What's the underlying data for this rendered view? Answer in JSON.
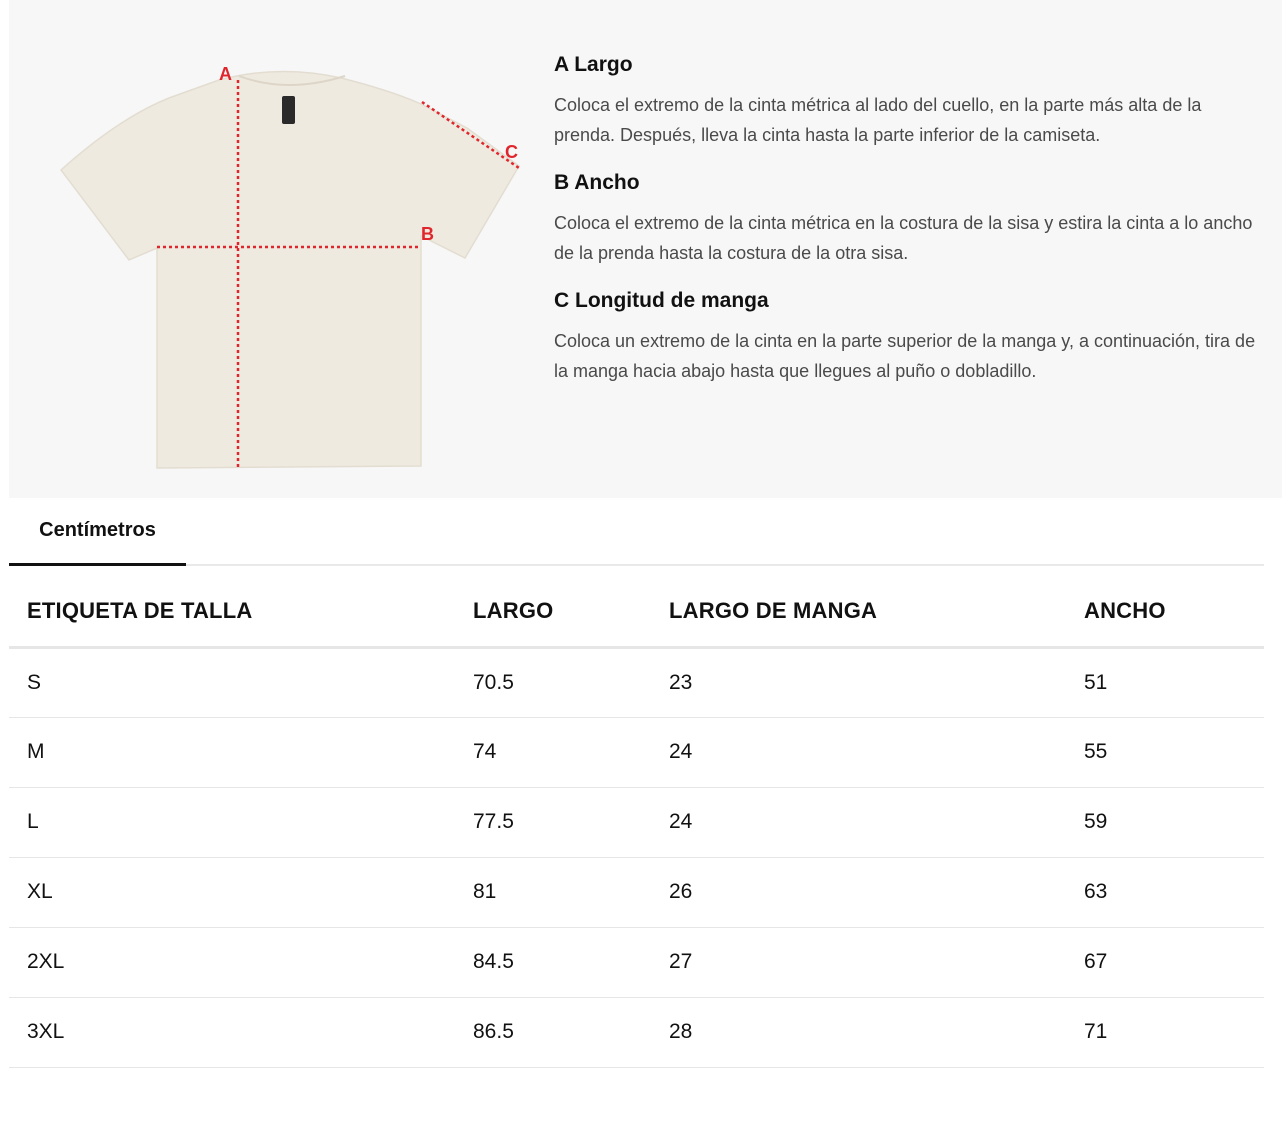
{
  "measurement_guide": {
    "markers": {
      "a": "A",
      "b": "B",
      "c": "C"
    },
    "items": [
      {
        "title": "A Largo",
        "text": "Coloca el extremo de la cinta métrica al lado del cuello, en la parte más alta de la prenda. Después, lleva la cinta hasta la parte inferior de la camiseta."
      },
      {
        "title": "B Ancho",
        "text": "Coloca el extremo de la cinta métrica en la costura de la sisa y estira la cinta a lo ancho de la prenda hasta la costura de la otra sisa."
      },
      {
        "title": "C Longitud de manga",
        "text": "Coloca un extremo de la cinta en la parte superior de la manga y, a continuación, tira de la manga hacia abajo hasta que llegues al puño o dobladillo."
      }
    ],
    "colors": {
      "shirt": "#efeae0",
      "measure_line": "#e0262d",
      "panel": "#f7f7f7"
    }
  },
  "tabs": {
    "active_label": "Centímetros"
  },
  "size_table": {
    "headers": [
      "ETIQUETA DE TALLA",
      "LARGO",
      "LARGO DE MANGA",
      "ANCHO"
    ],
    "rows": [
      [
        "S",
        "70.5",
        "23",
        "51"
      ],
      [
        "M",
        "74",
        "24",
        "55"
      ],
      [
        "L",
        "77.5",
        "24",
        "59"
      ],
      [
        "XL",
        "81",
        "26",
        "63"
      ],
      [
        "2XL",
        "84.5",
        "27",
        "67"
      ],
      [
        "3XL",
        "86.5",
        "28",
        "71"
      ]
    ]
  }
}
